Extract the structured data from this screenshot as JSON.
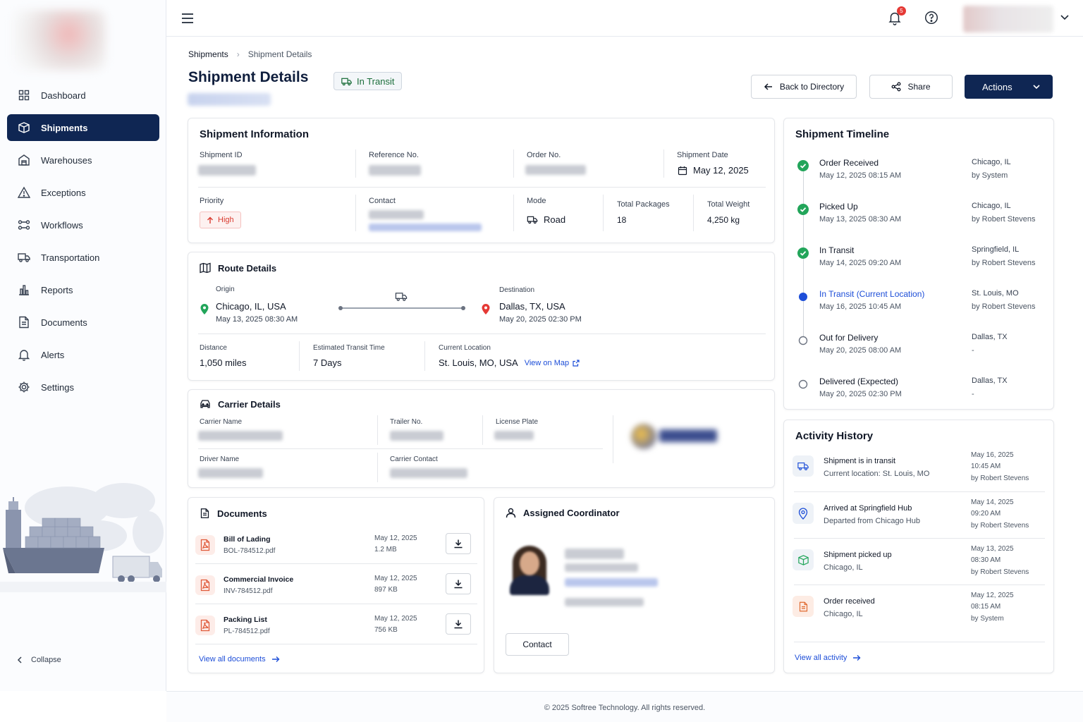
{
  "sidebar": {
    "items": [
      {
        "label": "Dashboard",
        "icon": "dashboard-icon"
      },
      {
        "label": "Shipments",
        "icon": "shipments-icon",
        "active": true
      },
      {
        "label": "Warehouses",
        "icon": "warehouse-icon"
      },
      {
        "label": "Exceptions",
        "icon": "warning-icon"
      },
      {
        "label": "Workflows",
        "icon": "workflow-icon"
      },
      {
        "label": "Transportation",
        "icon": "truck-icon"
      },
      {
        "label": "Reports",
        "icon": "reports-icon"
      },
      {
        "label": "Documents",
        "icon": "document-icon"
      },
      {
        "label": "Alerts",
        "icon": "bell-icon"
      },
      {
        "label": "Settings",
        "icon": "gear-icon"
      }
    ],
    "collapse_label": "Collapse"
  },
  "topbar": {
    "notification_count": "5"
  },
  "header": {
    "breadcrumb": [
      "Shipments",
      "Shipment Details"
    ],
    "title": "Shipment Details",
    "status": "In Transit",
    "back_label": "Back to Directory",
    "share_label": "Share",
    "actions_label": "Actions"
  },
  "shipment_info": {
    "title": "Shipment Information",
    "shipment_id_label": "Shipment ID",
    "reference_label": "Reference No.",
    "order_label": "Order No.",
    "date_label": "Shipment Date",
    "date_value": "May 12, 2025",
    "priority_label": "Priority",
    "priority_value": "High",
    "contact_label": "Contact",
    "mode_label": "Mode",
    "mode_value": "Road",
    "packages_label": "Total Packages",
    "packages_value": "18",
    "weight_label": "Total Weight",
    "weight_value": "4,250 kg"
  },
  "route": {
    "title": "Route Details",
    "origin_label": "Origin",
    "origin_value": "Chicago, IL, USA",
    "origin_date": "May 13, 2025 08:30 AM",
    "destination_label": "Destination",
    "destination_value": "Dallas, TX, USA",
    "destination_date": "May 20, 2025 02:30 PM",
    "distance_label": "Distance",
    "distance_value": "1,050 miles",
    "transit_label": "Estimated Transit Time",
    "transit_value": "7 Days",
    "current_label": "Current Location",
    "current_value": "St. Louis, MO, USA",
    "map_link": "View on Map"
  },
  "carrier": {
    "title": "Carrier Details",
    "carrier_name_label": "Carrier Name",
    "trailer_label": "Trailer No.",
    "plate_label": "License Plate",
    "driver_label": "Driver Name",
    "carrier_contact_label": "Carrier Contact"
  },
  "documents": {
    "title": "Documents",
    "items": [
      {
        "name": "Bill of Lading",
        "file": "BOL-784512.pdf",
        "date": "May 12, 2025",
        "size": "1.2 MB"
      },
      {
        "name": "Commercial Invoice",
        "file": "INV-784512.pdf",
        "date": "May 12, 2025",
        "size": "897 KB"
      },
      {
        "name": "Packing List",
        "file": "PL-784512.pdf",
        "date": "May 12, 2025",
        "size": "756 KB"
      }
    ],
    "view_all": "View all documents"
  },
  "coordinator": {
    "title": "Assigned Coordinator",
    "contact_button": "Contact"
  },
  "timeline": {
    "title": "Shipment Timeline",
    "items": [
      {
        "title": "Order Received",
        "date": "May 12, 2025 08:15 AM",
        "location": "Chicago, IL",
        "by": "by System",
        "state": "done"
      },
      {
        "title": "Picked Up",
        "date": "May 13, 2025 08:30 AM",
        "location": "Chicago, IL",
        "by": "by Robert Stevens",
        "state": "done"
      },
      {
        "title": "In Transit",
        "date": "May 14, 2025 09:20 AM",
        "location": "Springfield, IL",
        "by": "by Robert Stevens",
        "state": "done"
      },
      {
        "title": "In Transit (Current Location)",
        "date": "May 16, 2025 10:45 AM",
        "location": "St. Louis, MO",
        "by": "by Robert Stevens",
        "state": "current"
      },
      {
        "title": "Out for Delivery",
        "date": "May 20, 2025 08:00 AM",
        "location": "Dallas, TX",
        "by": "-",
        "state": "pending"
      },
      {
        "title": "Delivered (Expected)",
        "date": "May 20, 2025 02:30 PM",
        "location": "Dallas, TX",
        "by": "-",
        "state": "pending"
      }
    ]
  },
  "activity": {
    "title": "Activity History",
    "items": [
      {
        "title": "Shipment is in transit",
        "sub": "Current location: St. Louis, MO",
        "date": "May 16, 2025",
        "time": "10:45 AM",
        "by": "by Robert Stevens",
        "icon": "truck-icon"
      },
      {
        "title": "Arrived at Springfield Hub",
        "sub": "Departed from Chicago Hub",
        "date": "May 14, 2025",
        "time": "09:20 AM",
        "by": "by Robert Stevens",
        "icon": "location-pin-icon"
      },
      {
        "title": "Shipment picked up",
        "sub": "Chicago, IL",
        "date": "May 13, 2025",
        "time": "08:30 AM",
        "by": "by Robert Stevens",
        "icon": "package-icon"
      },
      {
        "title": "Order received",
        "sub": "Chicago, IL",
        "date": "May 12, 2025",
        "time": "08:15 AM",
        "by": "by System",
        "icon": "document-icon"
      }
    ],
    "view_all": "View all activity"
  },
  "footer": {
    "text": "© 2025 Softree Technology. All rights reserved."
  },
  "colors": {
    "primary": "#0f2653",
    "accent_blue": "#1d4ed8",
    "success": "#22a55a",
    "danger": "#e53935"
  }
}
